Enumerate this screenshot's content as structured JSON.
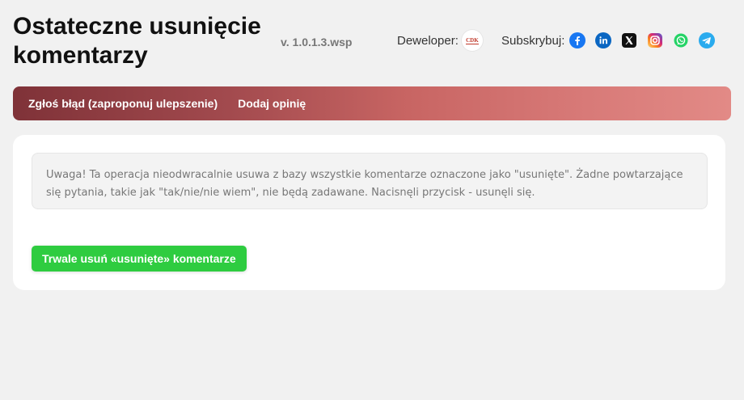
{
  "header": {
    "title": "Ostateczne usunięcie komentarzy",
    "version": "v. 1.0.1.3.wsp",
    "developer_label": "Deweloper:",
    "developer_logo_text": "CDK",
    "subscribe_label": "Subskrybuj:",
    "social_icons": [
      "facebook-icon",
      "linkedin-icon",
      "x-icon",
      "instagram-icon",
      "whatsapp-icon",
      "telegram-icon"
    ]
  },
  "nav": {
    "report_bug": "Zgłoś błąd (zaproponuj ulepszenie)",
    "add_review": "Dodaj opinię"
  },
  "main": {
    "warning_text": "Uwaga! Ta operacja nieodwracalnie usuwa z bazy wszystkie komentarze oznaczone jako \"usunięte\". Żadne powtarzające się pytania, takie jak \"tak/nie/nie wiem\", nie będą zadawane. Nacisnęli przycisk - usunęli się.",
    "delete_button": "Trwale usuń «usunięte» komentarze"
  },
  "colors": {
    "nav_gradient_start": "#7f3238",
    "nav_gradient_end": "#e28a86",
    "button_green": "#2ecc40",
    "facebook": "#1877f2",
    "linkedin": "#0a66c2",
    "x": "#111111",
    "instagram": "#e1306c",
    "whatsapp": "#25d366",
    "telegram": "#2aabee"
  }
}
